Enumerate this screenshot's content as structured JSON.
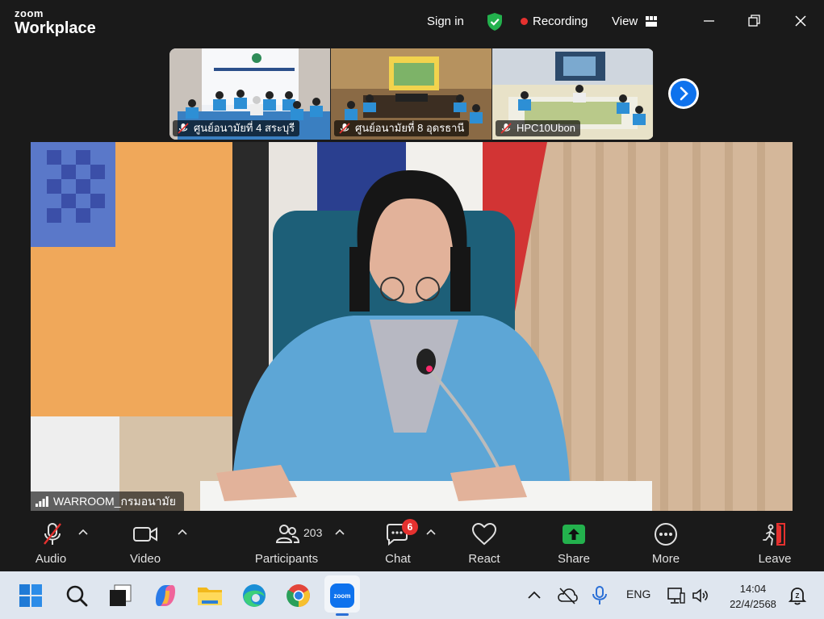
{
  "titlebar": {
    "logo_top": "zoom",
    "logo_bottom": "Workplace",
    "sign_in": "Sign in",
    "recording": "Recording",
    "view": "View",
    "colors": {
      "secure": "#23b14d",
      "recording_dot": "#e5312f"
    }
  },
  "thumbnails": [
    {
      "name": "ศูนย์อนามัยที่ 4 สระบุรี",
      "muted": true
    },
    {
      "name": "ศูนย์อนามัยที่ 8 อุดรธานี",
      "muted": true
    },
    {
      "name": "HPC10Ubon",
      "muted": true
    }
  ],
  "active_speaker": {
    "name": "WARROOM_กรมอนามัย"
  },
  "toolbar": {
    "audio": "Audio",
    "video": "Video",
    "participants": "Participants",
    "participants_count": "203",
    "chat": "Chat",
    "chat_badge": "6",
    "react": "React",
    "share": "Share",
    "more": "More",
    "leave": "Leave",
    "colors": {
      "share": "#23b14d",
      "badge": "#e5312f"
    }
  },
  "taskbar": {
    "apps": [
      "windows-start",
      "search",
      "task-view",
      "copilot",
      "file-explorer",
      "edge",
      "chrome",
      "zoom"
    ],
    "tray_language": "ENG",
    "time": "14:04",
    "date": "22/4/2568"
  }
}
